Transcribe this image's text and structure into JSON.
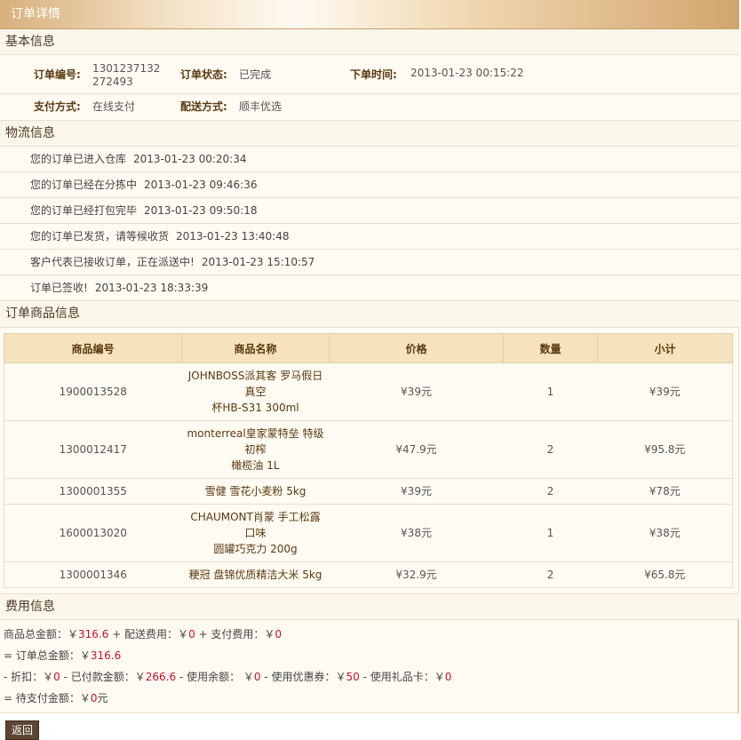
{
  "title": "订单详情",
  "basic": {
    "heading": "基本信息",
    "order_no_label": "订单编号:",
    "order_no_value": "1301237132272493",
    "status_label": "订单状态:",
    "status_value": "已完成",
    "time_label": "下单时间:",
    "time_value": "2013-01-23 00:15:22",
    "pay_label": "支付方式:",
    "pay_value": "在线支付",
    "ship_label": "配送方式:",
    "ship_value": "顺丰优选"
  },
  "logistics": {
    "heading": "物流信息",
    "entries": [
      {
        "text": "您的订单已进入仓库",
        "time": "2013-01-23 00:20:34"
      },
      {
        "text": "您的订单已经在分拣中",
        "time": "2013-01-23 09:46:36"
      },
      {
        "text": "您的订单已经打包完毕",
        "time": "2013-01-23 09:50:18"
      },
      {
        "text": "您的订单已发货，请等候收货",
        "time": "2013-01-23 13:40:48"
      },
      {
        "text": "客户代表已接收订单，正在派送中!",
        "time": "2013-01-23 15:10:57"
      },
      {
        "text": "订单已签收!",
        "time": "2013-01-23 18:33:39"
      }
    ]
  },
  "items": {
    "heading": "订单商品信息",
    "columns": [
      "商品编号",
      "商品名称",
      "价格",
      "数量",
      "小计"
    ],
    "rows": [
      {
        "code": "1900013528",
        "name_line1": "JOHNBOSS派其客 罗马假日真空",
        "name_line2": "杯HB-S31 300ml",
        "price": "¥39元",
        "qty": "1",
        "subtotal": "¥39元"
      },
      {
        "code": "1300012417",
        "name_line1": "monterreal皇家蒙特垒 特级初榨",
        "name_line2": "橄榄油 1L",
        "price": "¥47.9元",
        "qty": "2",
        "subtotal": "¥95.8元"
      },
      {
        "code": "1300001355",
        "name_line1": "雪健 雪花小麦粉 5kg",
        "name_line2": "",
        "price": "¥39元",
        "qty": "2",
        "subtotal": "¥78元"
      },
      {
        "code": "1600013020",
        "name_line1": "CHAUMONT肖蒙 手工松露口味",
        "name_line2": "圆罐巧克力 200g",
        "price": "¥38元",
        "qty": "1",
        "subtotal": "¥38元"
      },
      {
        "code": "1300001346",
        "name_line1": "粳冠 盘锦优质精洁大米 5kg",
        "name_line2": "",
        "price": "¥32.9元",
        "qty": "2",
        "subtotal": "¥65.8元"
      }
    ]
  },
  "fees": {
    "heading": "费用信息",
    "line1": {
      "goods_label": "商品总金额：￥",
      "goods_value": "316.6",
      "ship_label": " + 配送费用：￥",
      "ship_value": "0",
      "pay_label": " + 支付费用：￥",
      "pay_value": "0"
    },
    "line2": {
      "label": "= 订单总金额：￥",
      "value": "316.6"
    },
    "line3": {
      "discount_label": "- 折扣：￥",
      "discount_value": "0",
      "paid_label": " - 已付款金额：￥",
      "paid_value": "266.6",
      "balance_label": " - 使用余额： ￥",
      "balance_value": "0",
      "coupon_label": " - 使用优惠券：￥",
      "coupon_value": "50",
      "gift_label": " - 使用礼品卡：￥",
      "gift_value": "0"
    },
    "line4": {
      "label": "= 待支付金额：￥",
      "value": "0",
      "suffix": "元"
    }
  },
  "back_label": "返回"
}
